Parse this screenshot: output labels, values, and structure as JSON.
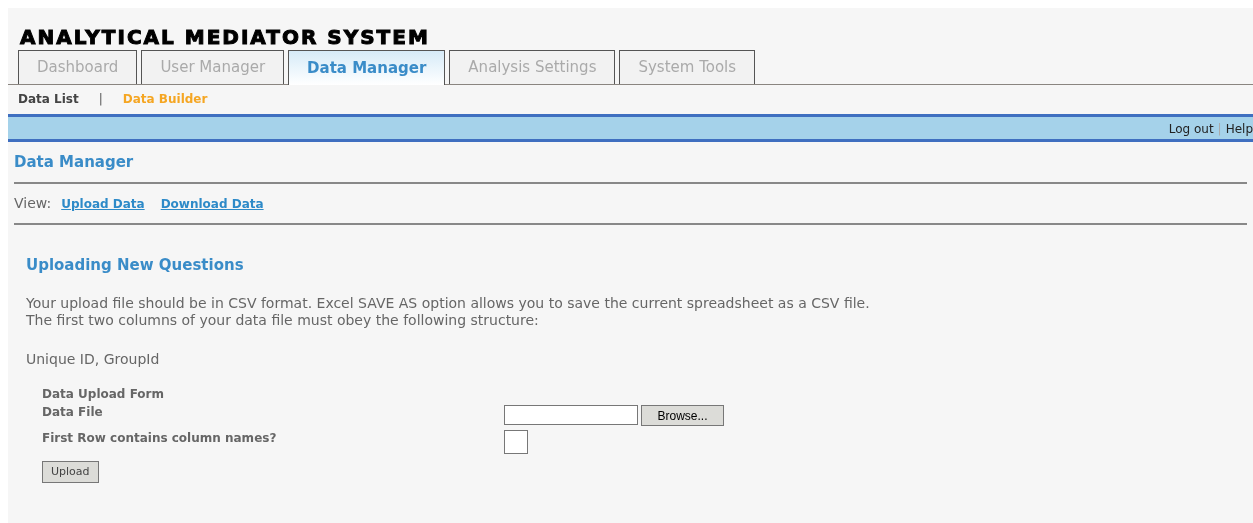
{
  "app_title": "ANALYTICAL MEDIATOR SYSTEM",
  "tabs": [
    {
      "label": "Dashboard",
      "selected": false
    },
    {
      "label": "User Manager",
      "selected": false
    },
    {
      "label": "Data Manager",
      "selected": true
    },
    {
      "label": "Analysis Settings",
      "selected": false
    },
    {
      "label": "System Tools",
      "selected": false
    }
  ],
  "sub_nav": [
    {
      "label": "Data List",
      "selected": false
    },
    {
      "label": "Data Builder",
      "selected": true
    }
  ],
  "sub_nav_separator": "|",
  "top_links": [
    "Log out",
    "Help"
  ],
  "top_links_separator": "|",
  "page_title": "Data Manager",
  "view": {
    "label": "View:",
    "links": [
      "Upload Data",
      "Download Data"
    ]
  },
  "section_title": "Uploading New Questions",
  "description": [
    "Your upload file should be in CSV format. Excel SAVE AS option allows you to save the current spreadsheet as a CSV file.",
    "The first two columns of your data file must obey the following structure:"
  ],
  "structure": "Unique ID, GroupId",
  "form": {
    "title": "Data Upload Form",
    "file_label": "Data File",
    "browse_button": "Browse...",
    "checkbox_label": "First Row contains column names?",
    "checked": false,
    "submit_button": "Upload"
  }
}
